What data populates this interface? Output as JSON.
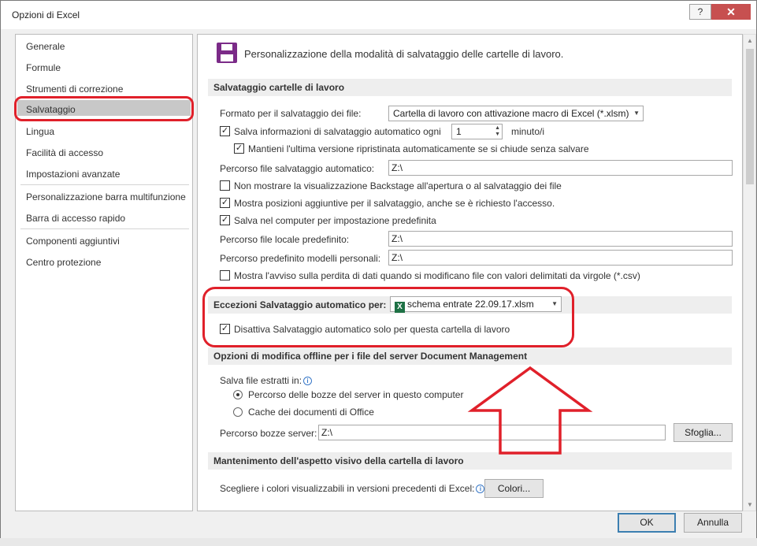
{
  "window": {
    "title": "Opzioni di Excel",
    "help_label": "?",
    "close_label": "✕"
  },
  "sidebar": {
    "items": [
      {
        "label": "Generale"
      },
      {
        "label": "Formule"
      },
      {
        "label": "Strumenti di correzione"
      },
      {
        "label": "Salvataggio"
      },
      {
        "label": "Lingua"
      },
      {
        "label": "Facilità di accesso"
      },
      {
        "label": "Impostazioni avanzate"
      },
      {
        "label": "Personalizzazione barra multifunzione"
      },
      {
        "label": "Barra di accesso rapido"
      },
      {
        "label": "Componenti aggiuntivi"
      },
      {
        "label": "Centro protezione"
      }
    ],
    "selected": "Salvataggio"
  },
  "main": {
    "heading": "Personalizzazione della modalità di salvataggio delle cartelle di lavoro.",
    "save_section": {
      "title": "Salvataggio cartelle di lavoro",
      "format_label": "Formato per il salvataggio dei file:",
      "format_value": "Cartella di lavoro con attivazione macro di Excel (*.xlsm)",
      "autorecover_label": "Salva informazioni di salvataggio automatico ogni",
      "autorecover_value": "1",
      "autorecover_unit": "minuto/i",
      "keep_last_label": "Mantieni l'ultima versione ripristinata automaticamente se si chiude senza salvare",
      "autorecover_path_label": "Percorso file salvataggio automatico:",
      "autorecover_path_value": "Z:\\",
      "no_backstage_label": "Non mostrare la visualizzazione Backstage all'apertura o al salvataggio dei file",
      "show_more_places_label": "Mostra posizioni aggiuntive per il salvataggio, anche se è richiesto l'accesso.",
      "save_to_computer_label": "Salva nel computer per impostazione predefinita",
      "local_path_label": "Percorso file locale predefinito:",
      "local_path_value": "Z:\\",
      "templates_path_label": "Percorso predefinito modelli personali:",
      "templates_path_value": "Z:\\",
      "csv_warning_label": "Mostra l'avviso sulla perdita di dati quando si modificano file con valori delimitati da virgole (*.csv)"
    },
    "autorecover_exceptions": {
      "title": "Eccezioni Salvataggio automatico per:",
      "workbook_value": "schema entrate 22.09.17.xlsm",
      "disable_label": "Disattiva Salvataggio automatico solo per questa cartella di lavoro"
    },
    "offline_section": {
      "title": "Opzioni di modifica offline per i file del server Document Management",
      "save_checked_out_label": "Salva file estratti in:",
      "server_drafts_label": "Percorso delle bozze del server in questo computer",
      "office_cache_label": "Cache dei documenti di Office",
      "drafts_path_label": "Percorso bozze server:",
      "drafts_path_value": "Z:\\",
      "browse_label": "Sfoglia..."
    },
    "visual_section": {
      "title": "Mantenimento dell'aspetto visivo della cartella di lavoro",
      "colors_label": "Scegliere i colori visualizzabili in versioni precedenti di Excel:",
      "colors_button": "Colori..."
    }
  },
  "footer": {
    "ok_label": "OK",
    "cancel_label": "Annulla"
  },
  "colors": {
    "annotation_red": "#e0202a",
    "save_icon": "#7b2b88",
    "excel_green": "#1e7145"
  }
}
